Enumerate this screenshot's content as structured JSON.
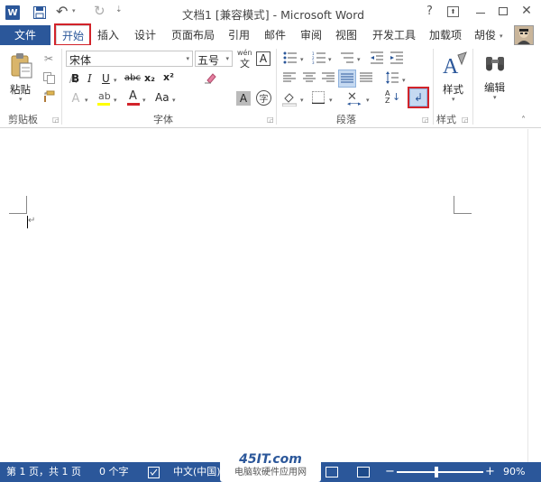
{
  "titlebar": {
    "title": "文档1 [兼容模式] - Microsoft Word",
    "help": "?",
    "undo": "↶",
    "redo": "↻"
  },
  "tabs": {
    "file": "文件",
    "items": [
      "开始",
      "插入",
      "设计",
      "页面布局",
      "引用",
      "邮件",
      "审阅",
      "视图",
      "开发工具",
      "加载项"
    ],
    "user": "胡俊"
  },
  "clipboard": {
    "paste": "粘贴",
    "group": "剪贴板"
  },
  "font": {
    "name": "宋体",
    "size": "五号",
    "wen_top": "wén",
    "wen_char": "文",
    "boxed_a": "A",
    "bold": "B",
    "italic": "I",
    "underline": "U",
    "strike": "abc",
    "sub": "x₂",
    "sup": "x²",
    "aa": "Aa",
    "circle": "字",
    "group": "字体"
  },
  "paragraph": {
    "group": "段落"
  },
  "styles": {
    "label": "样式",
    "group": "样式"
  },
  "editing": {
    "label": "编辑"
  },
  "watermark": {
    "logo": "45IT.com",
    "sub": "电脑软硬件应用网"
  },
  "status": {
    "page": "第 1 页，共 1 页",
    "words": "0 个字",
    "lang": "中文(中国)",
    "zoom": "90%",
    "minus": "−",
    "plus": "+"
  },
  "colors": {
    "accent": "#2b579a",
    "highlight_red": "#d2232a"
  }
}
